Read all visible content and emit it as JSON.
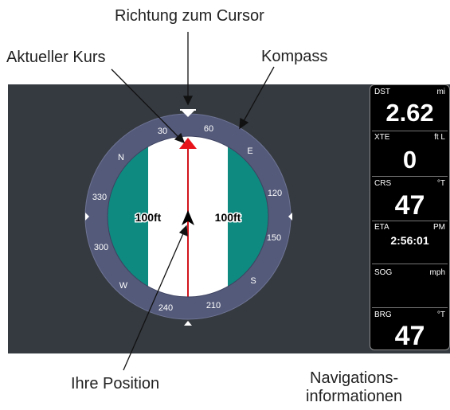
{
  "annotations": {
    "cursor_direction": "Richtung zum Cursor",
    "current_course": "Aktueller Kurs",
    "compass": "Kompass",
    "your_position": "Ihre Position",
    "nav_info_line1": "Navigations-",
    "nav_info_line2": "informationen"
  },
  "compass": {
    "labels": [
      "30",
      "60",
      "N",
      "E",
      "330",
      "120",
      "300",
      "150",
      "W",
      "S",
      "240",
      "210"
    ],
    "range_left": "100ft",
    "range_right": "100ft"
  },
  "nav_panel": {
    "dst": {
      "label": "DST",
      "unit": "mi",
      "value": "2.62"
    },
    "xte": {
      "label": "XTE",
      "unit": "ft L",
      "value": "0"
    },
    "crs": {
      "label": "CRS",
      "unit": "°T",
      "value": "47"
    },
    "eta": {
      "label": "ETA",
      "unit": "PM",
      "value": "2:56:01"
    },
    "sog": {
      "label": "SOG",
      "unit": "mph",
      "value": ""
    },
    "brg": {
      "label": "BRG",
      "unit": "°T",
      "value": "47"
    }
  },
  "colors": {
    "background": "#353a40",
    "compass_ring": "#545a7a",
    "lane_edge": "#0e8a80",
    "course_line": "#d2141c",
    "panel": "#000000"
  }
}
